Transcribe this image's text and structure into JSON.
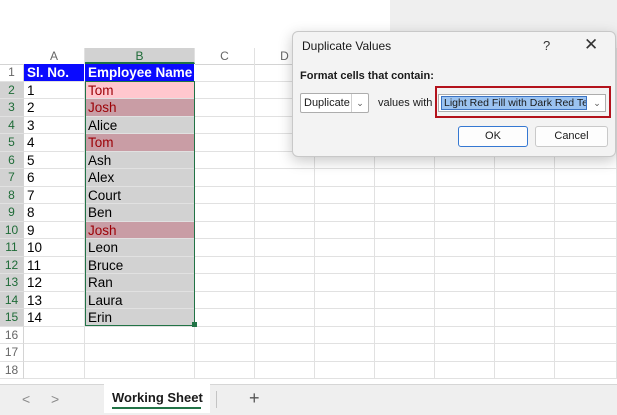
{
  "columns": [
    "A",
    "B",
    "C",
    "D"
  ],
  "row_numbers": [
    "1",
    "2",
    "3",
    "4",
    "5",
    "6",
    "7",
    "8",
    "9",
    "10",
    "11",
    "12",
    "13",
    "14",
    "15",
    "16",
    "17",
    "18"
  ],
  "table": {
    "headers": [
      "Sl. No.",
      "Employee Name"
    ],
    "rows": [
      {
        "no": "1",
        "name": "Tom"
      },
      {
        "no": "2",
        "name": "Josh"
      },
      {
        "no": "3",
        "name": "Alice"
      },
      {
        "no": "4",
        "name": "Tom"
      },
      {
        "no": "5",
        "name": "Ash"
      },
      {
        "no": "6",
        "name": "Alex"
      },
      {
        "no": "7",
        "name": "Court"
      },
      {
        "no": "8",
        "name": "Ben"
      },
      {
        "no": "9",
        "name": "Josh"
      },
      {
        "no": "10",
        "name": "Leon"
      },
      {
        "no": "11",
        "name": "Bruce"
      },
      {
        "no": "12",
        "name": "Ran"
      },
      {
        "no": "13",
        "name": "Laura"
      },
      {
        "no": "14",
        "name": "Erin"
      }
    ]
  },
  "dialog": {
    "title": "Duplicate Values",
    "help": "?",
    "close": "✕",
    "label": "Format cells that contain:",
    "type_value": "Duplicate",
    "values_with": "values with",
    "format_value": "Light Red Fill with Dark Red Text",
    "ok": "OK",
    "cancel": "Cancel"
  },
  "tabbar": {
    "nav_prev": "<",
    "nav_next": ">",
    "sheet_name": "Working Sheet",
    "add": "+"
  },
  "colors": {
    "header_fill": "#0a0aff",
    "duplicate_fill": "#ffc7ce",
    "duplicate_text": "#9c0006",
    "selection": "#217346",
    "highlight_box": "#b3121b"
  }
}
